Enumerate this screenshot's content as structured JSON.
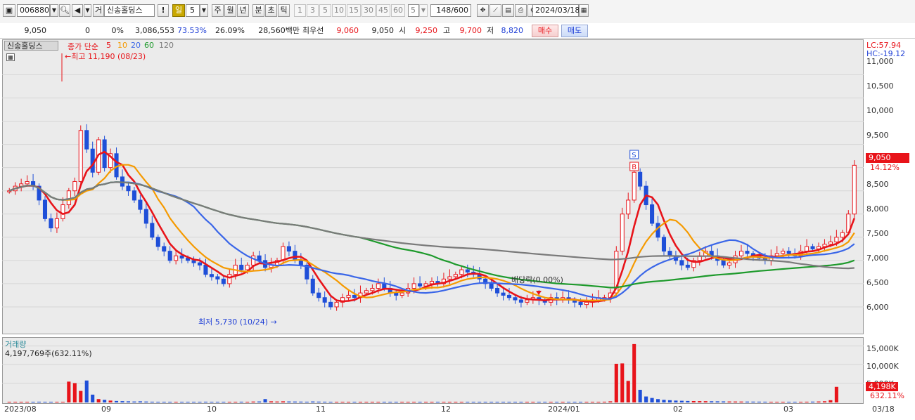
{
  "toolbar": {
    "code": "006880",
    "search_icon": "magnifier-icon",
    "sound_icon": "speaker-icon",
    "type_label": "거",
    "stock_name": "신송홀딩스",
    "alert_label": "!",
    "period_tabs": [
      "일",
      "5",
      "주",
      "월",
      "년",
      "분",
      "초",
      "틱"
    ],
    "period_selected": "일",
    "minute_units": [
      "1",
      "3",
      "5",
      "10",
      "15",
      "30",
      "45",
      "60"
    ],
    "unit_input": "5",
    "count_display": "148/600",
    "date": "2024/03/18"
  },
  "quote": {
    "price": "9,050",
    "change": "0",
    "change_pct": "0%",
    "volume": "3,086,553",
    "ratio1": "73.53%",
    "ratio2": "26.09%",
    "amount": "28,560백만",
    "best_label": "최우선",
    "best_ask": "9,060",
    "best_bid": "9,050",
    "open_label": "시",
    "open": "9,250",
    "high_label": "고",
    "high": "9,700",
    "low_label": "저",
    "low": "8,820",
    "buy_label": "매수",
    "sell_label": "매도"
  },
  "legend": {
    "name": "신송홀딩스",
    "kind": "종가 단순",
    "ma5": "5",
    "ma10": "10",
    "ma20": "20",
    "ma60": "60",
    "ma120": "120"
  },
  "annotations": {
    "high": "←최고 11,190 (08/23)",
    "low": "최저 5,730 (10/24) →",
    "dividend": "배당락(0.00%)",
    "signal_s": "S",
    "signal_b": "B",
    "lc": "LC:57.94",
    "hc": "HC:-19.12",
    "last_price": "9,050",
    "last_pct": "14.12%"
  },
  "volume_panel": {
    "title": "거래량",
    "value": "4,197,769주(632.11%)",
    "last_label": "4,198K",
    "last_pct": "632.11%",
    "overlapped_tick": "5,000K"
  },
  "y_ticks": [
    "11,000",
    "10,500",
    "10,000",
    "9,500",
    "9,000",
    "8,500",
    "8,000",
    "7,500",
    "7,000",
    "6,500",
    "6,000"
  ],
  "vol_ticks": [
    "15,000K",
    "10,000K"
  ],
  "x_labels": [
    "2023/08",
    "09",
    "10",
    "11",
    "12",
    "2024/01",
    "02",
    "03",
    "03/18"
  ],
  "colors": {
    "up": "#e8141a",
    "down": "#1f4fd8",
    "ma5": "#e8141a",
    "ma10": "#f59a00",
    "ma20": "#3a66e8",
    "ma60": "#1e9a2c",
    "ma120": "#7a7a7a"
  },
  "chart_data": {
    "type": "candlestick",
    "ylim": [
      5500,
      11400
    ],
    "x": [
      "2023/08",
      "09",
      "10",
      "11",
      "12",
      "2024/01",
      "02",
      "03",
      "03/18"
    ],
    "close": [
      8500,
      8600,
      8650,
      8700,
      8600,
      8300,
      7900,
      7700,
      7900,
      8200,
      8500,
      8700,
      9800,
      9400,
      8900,
      9600,
      9000,
      9300,
      8800,
      8600,
      8500,
      8300,
      8100,
      7800,
      7500,
      7300,
      7200,
      7000,
      7100,
      7050,
      7000,
      6950,
      6900,
      6700,
      6650,
      6600,
      6500,
      6700,
      6900,
      6800,
      6900,
      7100,
      7000,
      6850,
      6900,
      7000,
      7300,
      7200,
      7000,
      6900,
      6600,
      6300,
      6200,
      6100,
      6000,
      6100,
      6200,
      6250,
      6200,
      6300,
      6350,
      6400,
      6500,
      6400,
      6300,
      6250,
      6300,
      6400,
      6500,
      6450,
      6500,
      6550,
      6500,
      6600,
      6650,
      6700,
      6800,
      6750,
      6700,
      6600,
      6500,
      6400,
      6300,
      6250,
      6200,
      6150,
      6100,
      6150,
      6200,
      6150,
      6100,
      6200,
      6150,
      6200,
      6150,
      6100,
      6050,
      6100,
      6150,
      6200,
      6200,
      6300,
      7200,
      8000,
      8300,
      8900,
      8600,
      8200,
      7800,
      7500,
      7200,
      7100,
      7000,
      6900,
      6850,
      7000,
      7100,
      7200,
      7100,
      7000,
      6900,
      6950,
      7100,
      7200,
      7150,
      7100,
      7050,
      7000,
      7100,
      7150,
      7200,
      7150,
      7100,
      7200,
      7300,
      7250,
      7300,
      7350,
      7400,
      7500,
      7600,
      8000,
      9050
    ],
    "ma_series": [
      {
        "name": "5",
        "period": 5
      },
      {
        "name": "10",
        "period": 10
      },
      {
        "name": "20",
        "period": 20
      },
      {
        "name": "60",
        "period": 60
      },
      {
        "name": "120",
        "period": 120
      }
    ],
    "volume": [
      120,
      90,
      150,
      80,
      110,
      200,
      140,
      95,
      100,
      130,
      5600,
      5200,
      3100,
      5900,
      2100,
      900,
      700,
      500,
      400,
      350,
      300,
      250,
      300,
      240,
      200,
      180,
      150,
      160,
      170,
      150,
      160,
      170,
      140,
      200,
      180,
      150,
      160,
      170,
      190,
      200,
      180,
      240,
      260,
      900,
      300,
      250,
      300,
      260,
      240,
      220,
      200,
      260,
      220,
      200,
      180,
      160,
      150,
      140,
      160,
      150,
      170,
      160,
      180,
      170,
      150,
      160,
      170,
      180,
      160,
      150,
      140,
      150,
      160,
      150,
      160,
      170,
      180,
      170,
      160,
      150,
      140,
      160,
      150,
      140,
      130,
      140,
      130,
      120,
      130,
      140,
      130,
      120,
      130,
      140,
      130,
      120,
      130,
      140,
      150,
      160,
      200,
      300,
      10400,
      10500,
      5800,
      15700,
      3400,
      1600,
      1200,
      900,
      700,
      600,
      500,
      450,
      400,
      380,
      360,
      340,
      320,
      300,
      280,
      260,
      250,
      240,
      230,
      220,
      210,
      200,
      190,
      180,
      170,
      160,
      170,
      180,
      200,
      220,
      260,
      320,
      600,
      4198
    ]
  }
}
